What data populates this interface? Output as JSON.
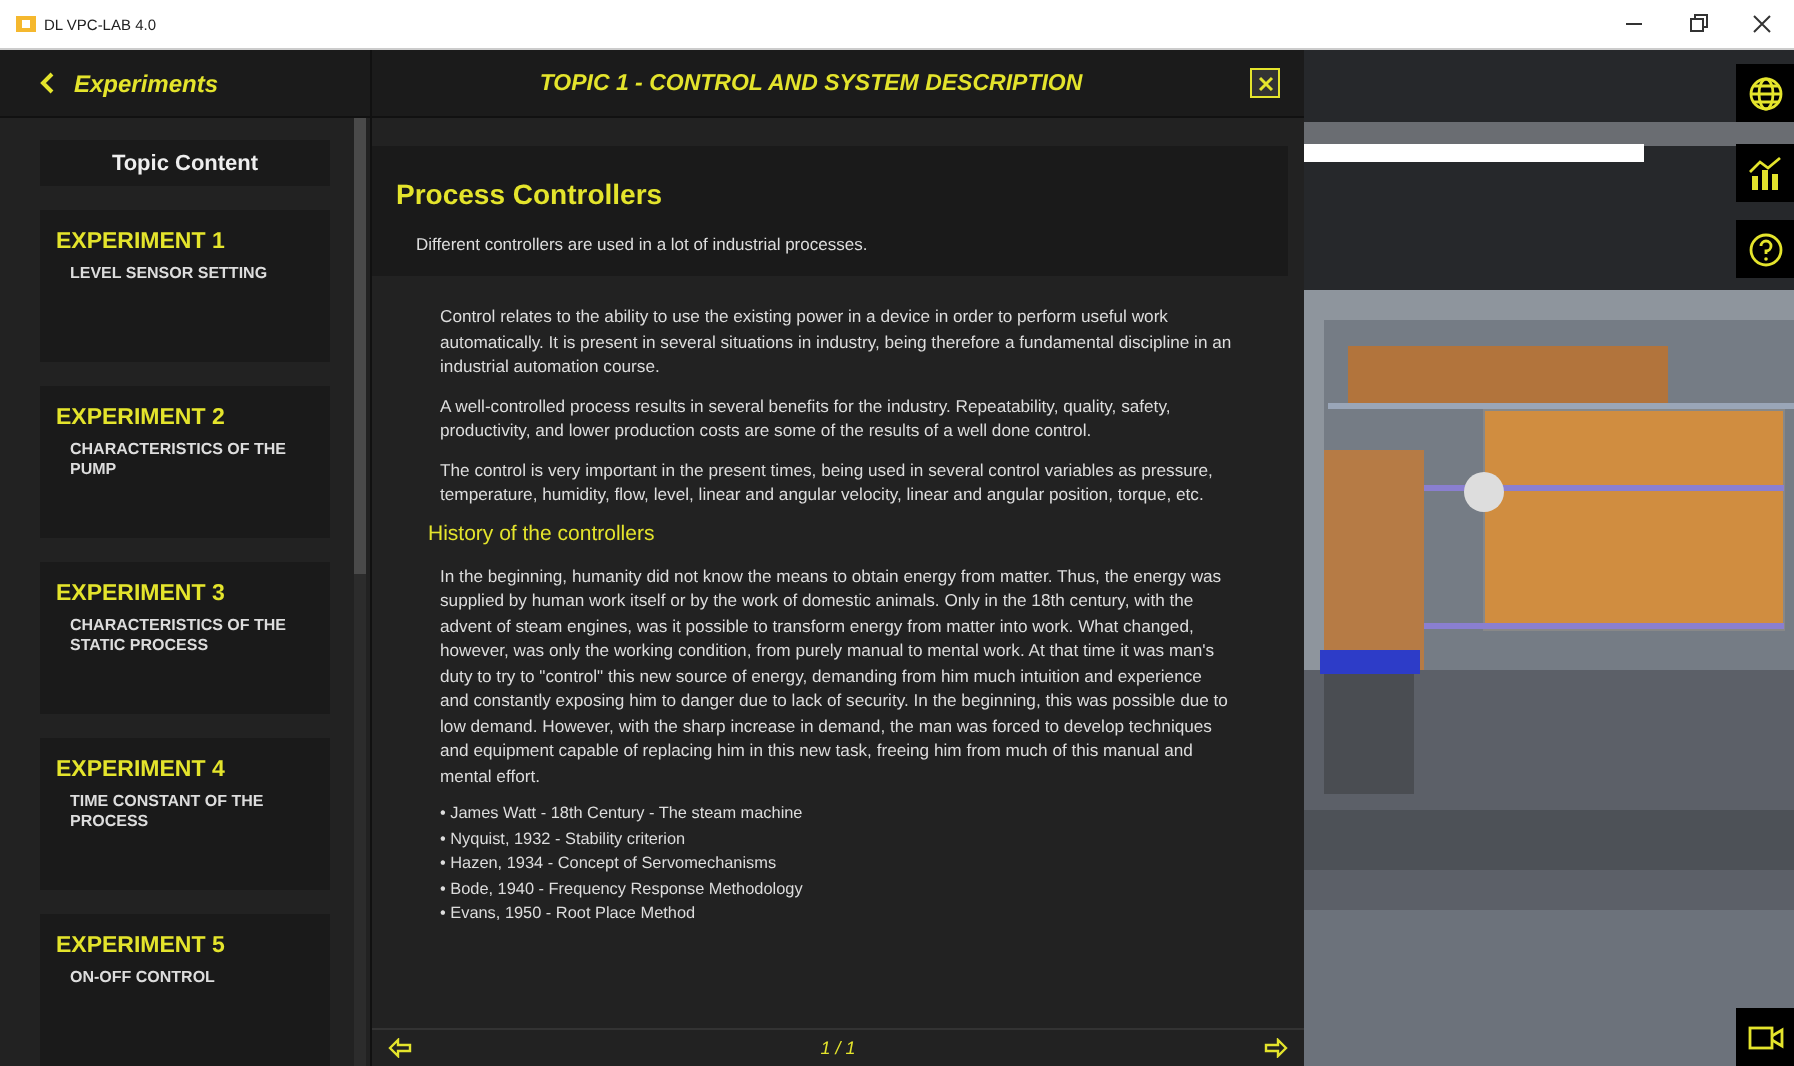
{
  "window": {
    "title": "DL VPC-LAB 4.0"
  },
  "sidebar": {
    "back_label": "Experiments",
    "topic_content": "Topic Content",
    "experiments": [
      {
        "title": "EXPERIMENT 1",
        "subtitle": "LEVEL SENSOR SETTING"
      },
      {
        "title": "EXPERIMENT 2",
        "subtitle": "CHARACTERISTICS OF THE PUMP"
      },
      {
        "title": "EXPERIMENT 3",
        "subtitle": "CHARACTERISTICS OF THE STATIC PROCESS"
      },
      {
        "title": "EXPERIMENT 4",
        "subtitle": "TIME CONSTANT OF THE PROCESS"
      },
      {
        "title": "EXPERIMENT 5",
        "subtitle": "ON-OFF CONTROL"
      }
    ]
  },
  "topic": {
    "title": "TOPIC 1 - CONTROL AND SYSTEM DESCRIPTION",
    "heading": "Process Controllers",
    "subheading": "Different controllers are used in a lot of industrial processes.",
    "paragraphs": [
      "Control relates to the ability to use the existing power in a device in order to perform useful work automatically. It is present in several situations in industry, being therefore a fundamental discipline in an industrial automation course.",
      "A well-controlled process results in several benefits for the industry. Repeatability, quality, safety, productivity, and lower production costs are some of the results of a well done control.",
      "The control is very important in the present times, being used in several control variables as pressure, temperature, humidity, flow, level, linear and angular velocity, linear and angular position, torque, etc."
    ],
    "section_heading": "History of the controllers",
    "history_paragraph": "In the beginning, humanity did not know the means to obtain energy from matter. Thus, the energy was supplied by human work itself or by the work of domestic animals. Only in the 18th century, with the advent of steam engines, was it possible to transform energy from matter into work. What changed, however, was only the working condition, from purely manual to mental work. At that time it was man's duty to try to \"control\" this new source of energy, demanding from him much intuition and experience and constantly exposing him to danger due to lack of security. In the beginning, this was possible due to low demand. However, with the sharp increase in demand, the man was forced to develop techniques and equipment capable of replacing him in this new task, freeing him from much of this manual and mental effort.",
    "milestones": [
      "• James Watt - 18th Century - The steam machine",
      "• Nyquist, 1932 - Stability criterion",
      "• Hazen, 1934 - Concept of Servomechanisms",
      "• Bode, 1940 - Frequency Response Methodology",
      "• Evans, 1950 - Root Place Method"
    ],
    "page": "1 / 1"
  }
}
